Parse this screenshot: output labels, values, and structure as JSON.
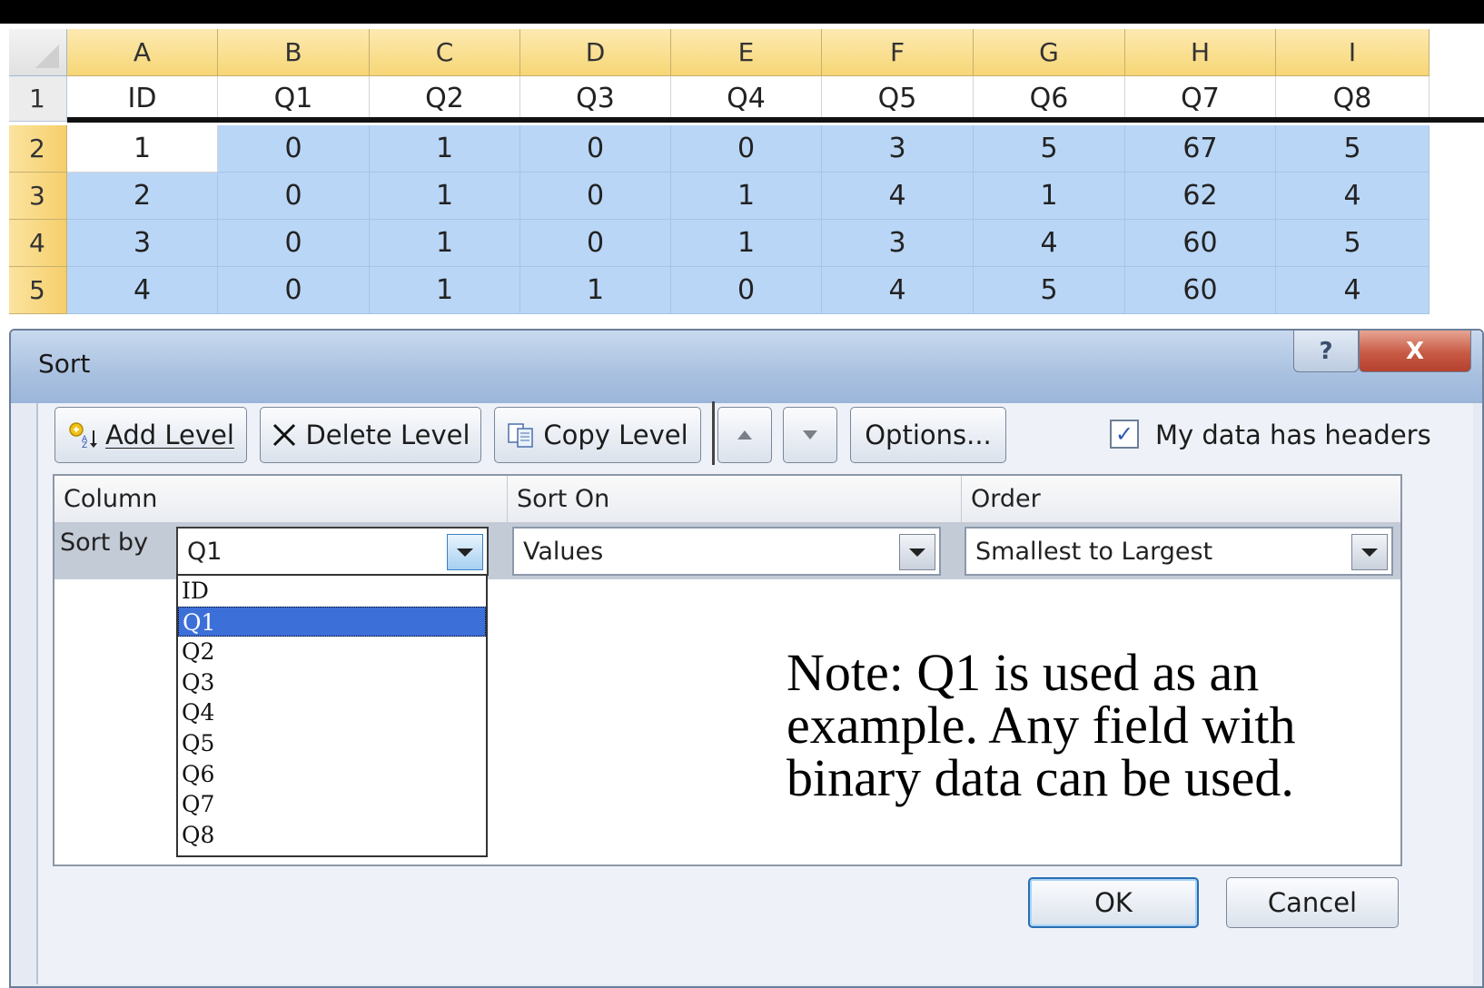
{
  "spreadsheet": {
    "columns": [
      "A",
      "B",
      "C",
      "D",
      "E",
      "F",
      "G",
      "H",
      "I"
    ],
    "header_row": {
      "num": "1",
      "cells": [
        "ID",
        "Q1",
        "Q2",
        "Q3",
        "Q4",
        "Q5",
        "Q6",
        "Q7",
        "Q8"
      ]
    },
    "rows": [
      {
        "num": "2",
        "cells": [
          "1",
          "0",
          "1",
          "0",
          "0",
          "3",
          "5",
          "67",
          "5"
        ]
      },
      {
        "num": "3",
        "cells": [
          "2",
          "0",
          "1",
          "0",
          "1",
          "4",
          "1",
          "62",
          "4"
        ]
      },
      {
        "num": "4",
        "cells": [
          "3",
          "0",
          "1",
          "0",
          "1",
          "3",
          "4",
          "60",
          "5"
        ]
      },
      {
        "num": "5",
        "cells": [
          "4",
          "0",
          "1",
          "1",
          "0",
          "4",
          "5",
          "60",
          "4"
        ]
      }
    ]
  },
  "dialog": {
    "title": "Sort",
    "help_label": "?",
    "close_label": "X",
    "toolbar": {
      "add_level": "Add Level",
      "delete_level": "Delete Level",
      "copy_level": "Copy Level",
      "options": "Options..."
    },
    "headers_checkbox": {
      "label": "My data has headers",
      "checked": true
    },
    "grid_headers": {
      "column": "Column",
      "sort_on": "Sort On",
      "order": "Order"
    },
    "sort_row": {
      "label": "Sort by",
      "column_value": "Q1",
      "sort_on_value": "Values",
      "order_value": "Smallest to Largest"
    },
    "column_options": [
      "ID",
      "Q1",
      "Q2",
      "Q3",
      "Q4",
      "Q5",
      "Q6",
      "Q7",
      "Q8"
    ],
    "selected_option": "Q1",
    "ok_label": "OK",
    "cancel_label": "Cancel"
  },
  "note": "Note: Q1 is used as an example. Any field with binary data can be used.",
  "colors": {
    "selection": "#b9d6f6",
    "header_gold": "#f7d675",
    "dialog_bg": "#e6ebf3",
    "accent_blue": "#3d6fd8"
  }
}
